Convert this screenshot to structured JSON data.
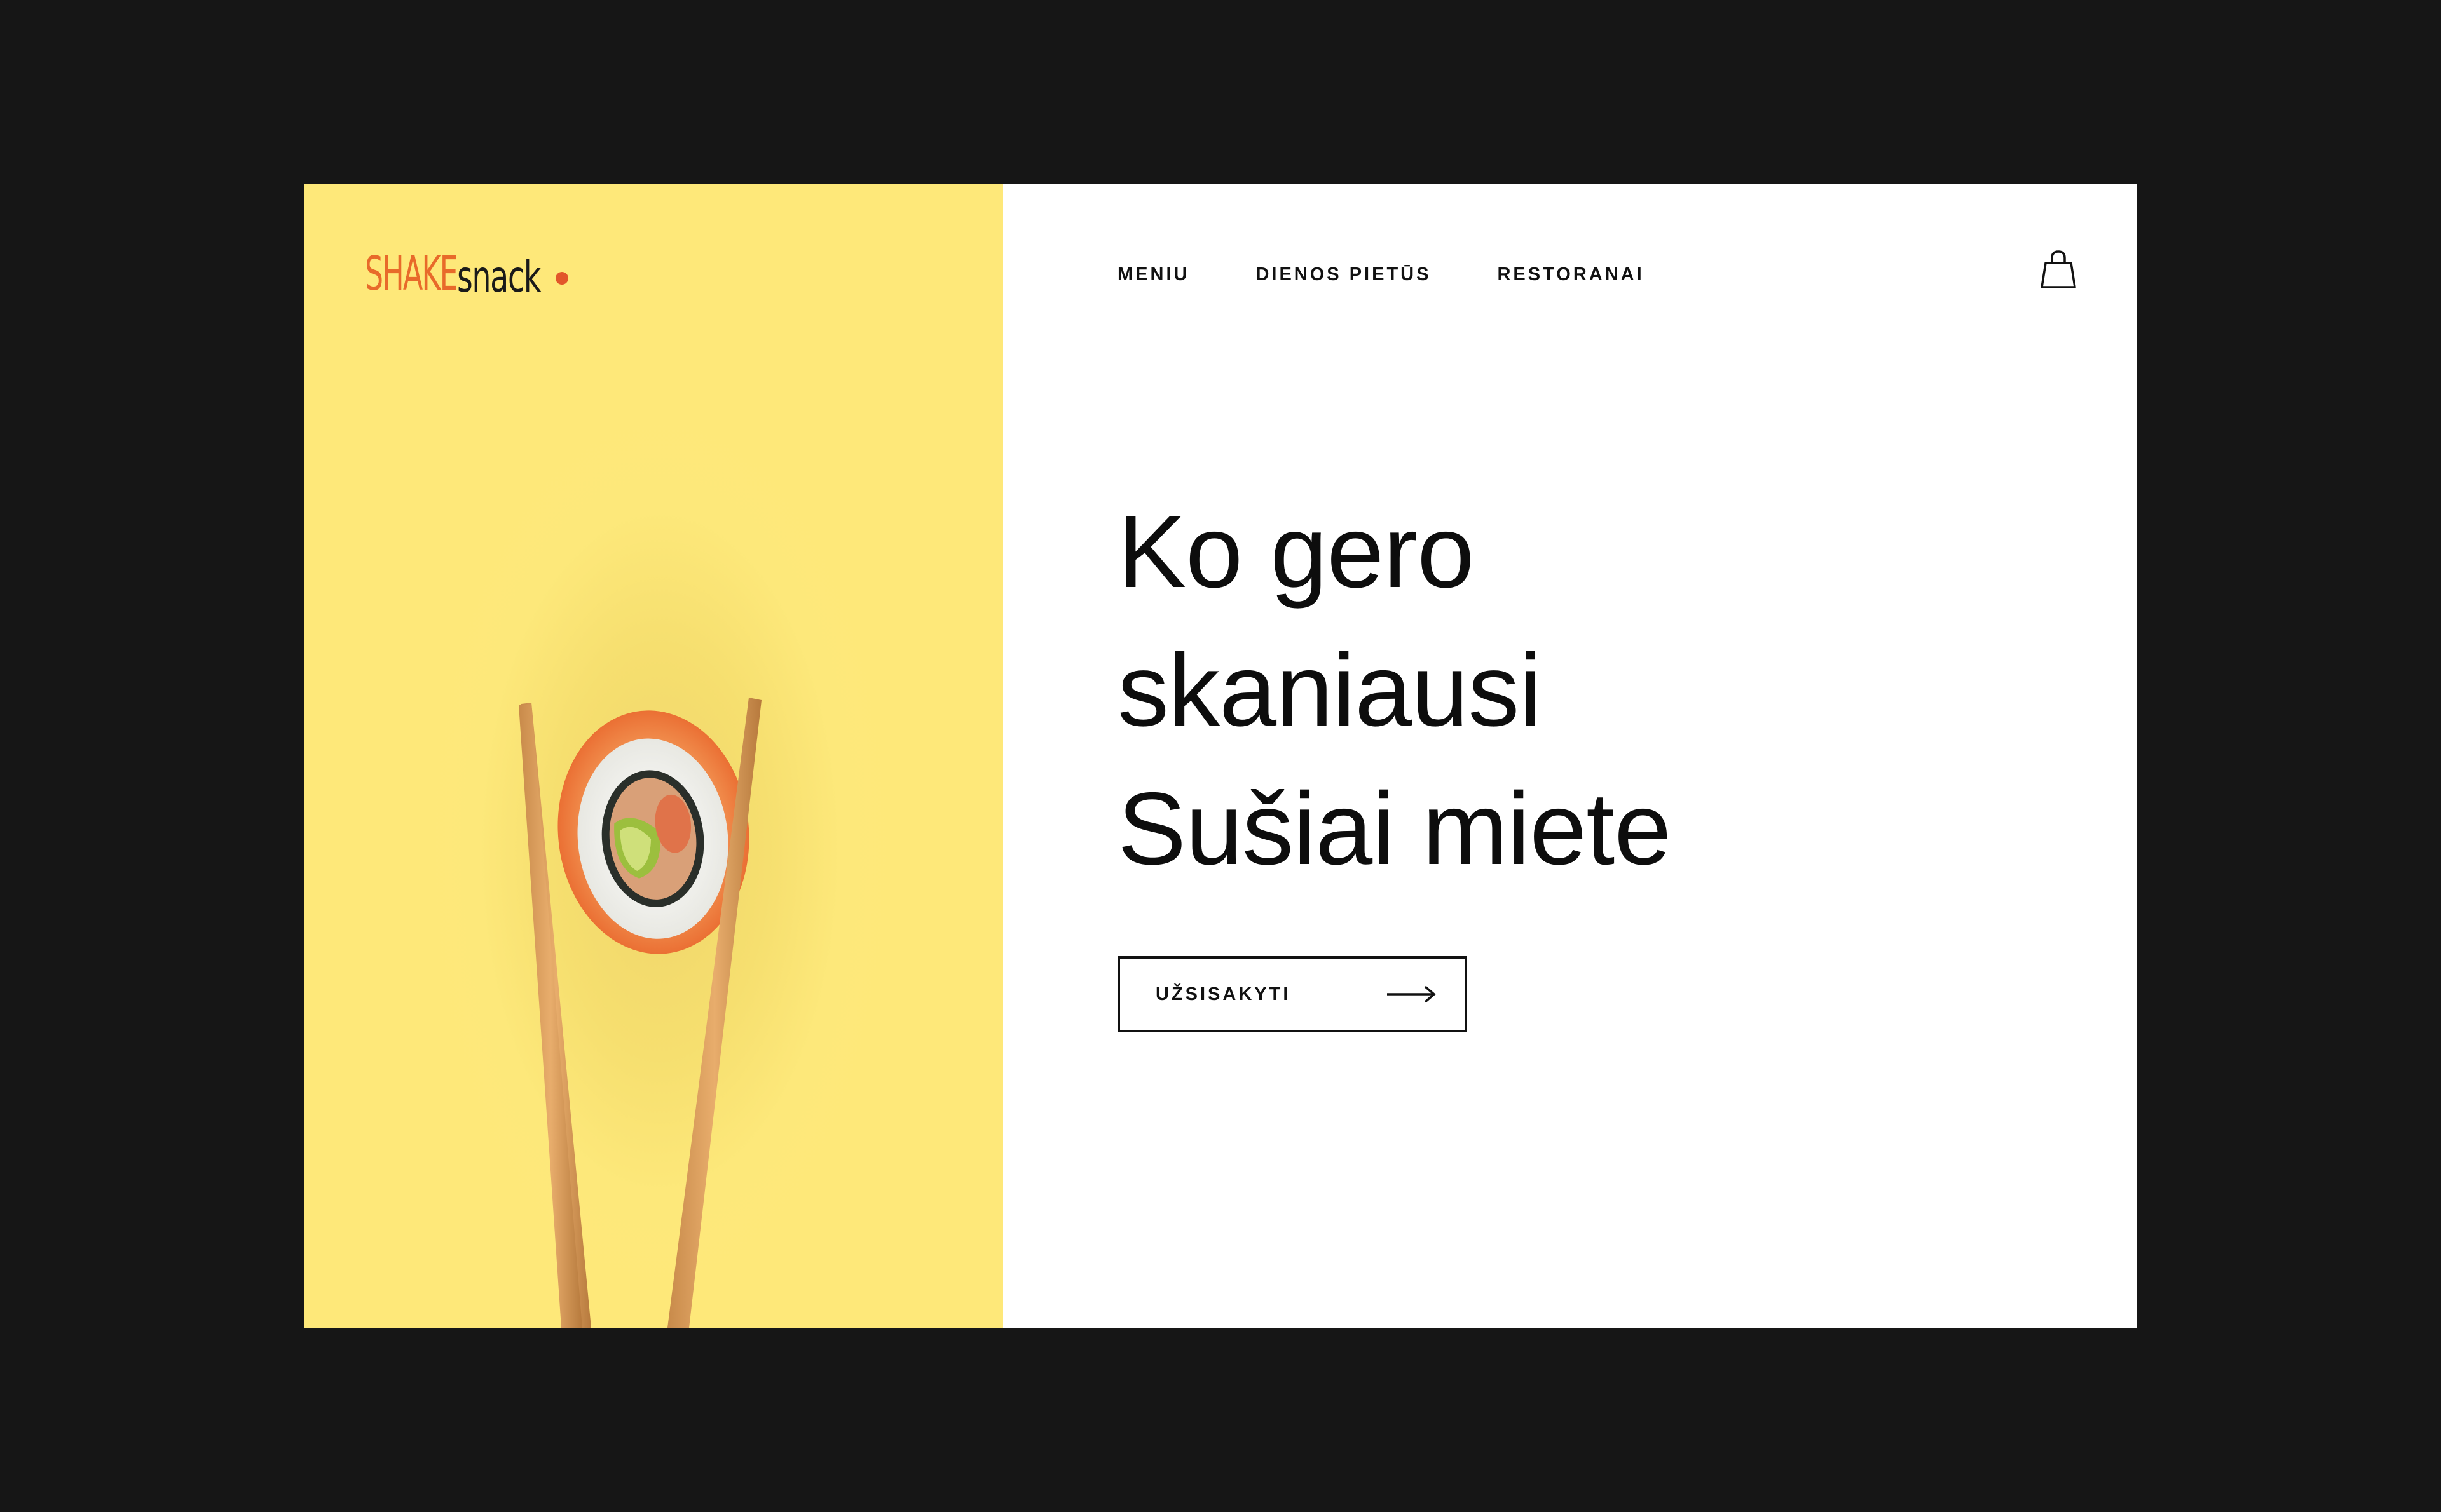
{
  "brand": {
    "logo_text": "SHAKEsnack"
  },
  "nav": {
    "items": [
      {
        "label": "MENIU"
      },
      {
        "label": "DIENOS PIETŪS"
      },
      {
        "label": "RESTORANAI"
      }
    ],
    "cart_icon": "shopping-bag-icon"
  },
  "hero": {
    "headline_lines": [
      "Ko gero",
      "skaniausi",
      "Sušiai miete"
    ],
    "cta": {
      "label": "UŽSISAKYTI",
      "icon": "arrow-right-icon"
    },
    "image": "sushi-roll-with-chopsticks"
  },
  "colors": {
    "panel_yellow": "#fee879",
    "backdrop": "#161616",
    "logo_orange": "#e86a2a",
    "text": "#111111"
  }
}
